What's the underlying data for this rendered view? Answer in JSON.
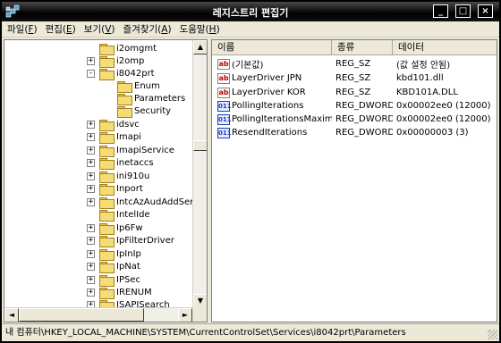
{
  "window": {
    "title": "레지스트리 편집기"
  },
  "menu": [
    {
      "label": "파일",
      "accel": "F"
    },
    {
      "label": "편집",
      "accel": "E"
    },
    {
      "label": "보기",
      "accel": "V"
    },
    {
      "label": "즐겨찾기",
      "accel": "A"
    },
    {
      "label": "도움말",
      "accel": "H"
    }
  ],
  "tree": [
    {
      "label": "i2omgmt",
      "expander": "",
      "indent": 0
    },
    {
      "label": "i2omp",
      "expander": "+",
      "indent": 0
    },
    {
      "label": "i8042prt",
      "expander": "-",
      "indent": 0
    },
    {
      "label": "Enum",
      "expander": "",
      "indent": 1
    },
    {
      "label": "Parameters",
      "expander": "",
      "indent": 1
    },
    {
      "label": "Security",
      "expander": "",
      "indent": 1
    },
    {
      "label": "idsvc",
      "expander": "+",
      "indent": 0
    },
    {
      "label": "Imapi",
      "expander": "+",
      "indent": 0
    },
    {
      "label": "ImapiService",
      "expander": "+",
      "indent": 0
    },
    {
      "label": "inetaccs",
      "expander": "+",
      "indent": 0
    },
    {
      "label": "ini910u",
      "expander": "+",
      "indent": 0
    },
    {
      "label": "Inport",
      "expander": "+",
      "indent": 0
    },
    {
      "label": "IntcAzAudAddServi",
      "expander": "+",
      "indent": 0
    },
    {
      "label": "IntelIde",
      "expander": "",
      "indent": 0
    },
    {
      "label": "Ip6Fw",
      "expander": "+",
      "indent": 0
    },
    {
      "label": "IpFilterDriver",
      "expander": "+",
      "indent": 0
    },
    {
      "label": "IpInIp",
      "expander": "+",
      "indent": 0
    },
    {
      "label": "IpNat",
      "expander": "+",
      "indent": 0
    },
    {
      "label": "IPSec",
      "expander": "+",
      "indent": 0
    },
    {
      "label": "IRENUM",
      "expander": "+",
      "indent": 0
    },
    {
      "label": "ISAPISearch",
      "expander": "+",
      "indent": 0
    }
  ],
  "columns": {
    "name": "이름",
    "type": "종류",
    "data": "데이터"
  },
  "values": [
    {
      "name": "(기본값)",
      "type": "REG_SZ",
      "data": "(값 설정 안됨)",
      "icon": "string-value-icon"
    },
    {
      "name": "LayerDriver JPN",
      "type": "REG_SZ",
      "data": "kbd101.dll",
      "icon": "string-value-icon"
    },
    {
      "name": "LayerDriver KOR",
      "type": "REG_SZ",
      "data": "KBD101A.DLL",
      "icon": "string-value-icon"
    },
    {
      "name": "PollingIterations",
      "type": "REG_DWORD",
      "data": "0x00002ee0 (12000)",
      "icon": "dword-value-icon"
    },
    {
      "name": "PollingIterationsMaximum",
      "type": "REG_DWORD",
      "data": "0x00002ee0 (12000)",
      "icon": "dword-value-icon"
    },
    {
      "name": "ResendIterations",
      "type": "REG_DWORD",
      "data": "0x00000003 (3)",
      "icon": "dword-value-icon"
    }
  ],
  "status": {
    "path": "내 컴퓨터\\HKEY_LOCAL_MACHINE\\SYSTEM\\CurrentControlSet\\Services\\i8042prt\\Parameters"
  },
  "icons": {
    "string": "ab",
    "dword": "011",
    "minimize": "_",
    "maximize": "□",
    "close": "×",
    "arrow_up": "▲",
    "arrow_down": "▼",
    "arrow_left": "◄",
    "arrow_right": "►"
  },
  "colors": {
    "titlebar": "#000000",
    "tree_folder": "#f6dc74",
    "string_icon": "#c00000",
    "dword_icon": "#1a3fb0"
  }
}
